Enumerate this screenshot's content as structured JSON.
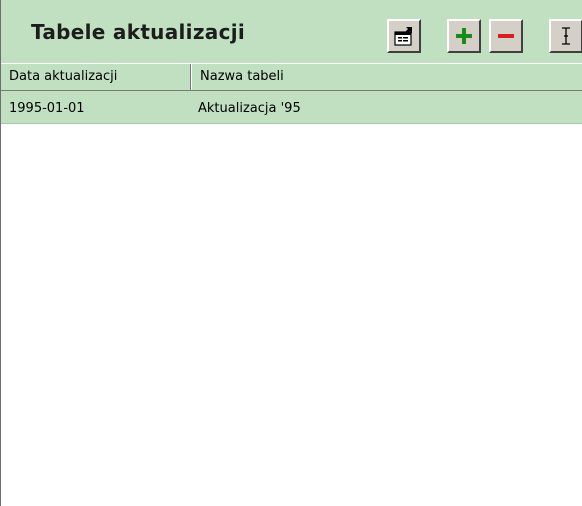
{
  "panel": {
    "title": "Tabele aktualizacji"
  },
  "toolbar": {
    "buttons": [
      {
        "name": "properties",
        "icon": "properties-icon"
      },
      {
        "name": "add",
        "icon": "plus-icon"
      },
      {
        "name": "remove",
        "icon": "minus-icon"
      },
      {
        "name": "edit",
        "icon": "text-cursor-icon"
      }
    ]
  },
  "table": {
    "columns": [
      "Data aktualizacji",
      "Nazwa tabeli"
    ],
    "rows": [
      {
        "date": "1995-01-01",
        "name": "Aktualizacja '95"
      }
    ]
  },
  "colors": {
    "header_bg": "#c1dfc1",
    "row_bg": "#c1dfc1",
    "plus": "#1a8a1a",
    "minus": "#d42020"
  }
}
